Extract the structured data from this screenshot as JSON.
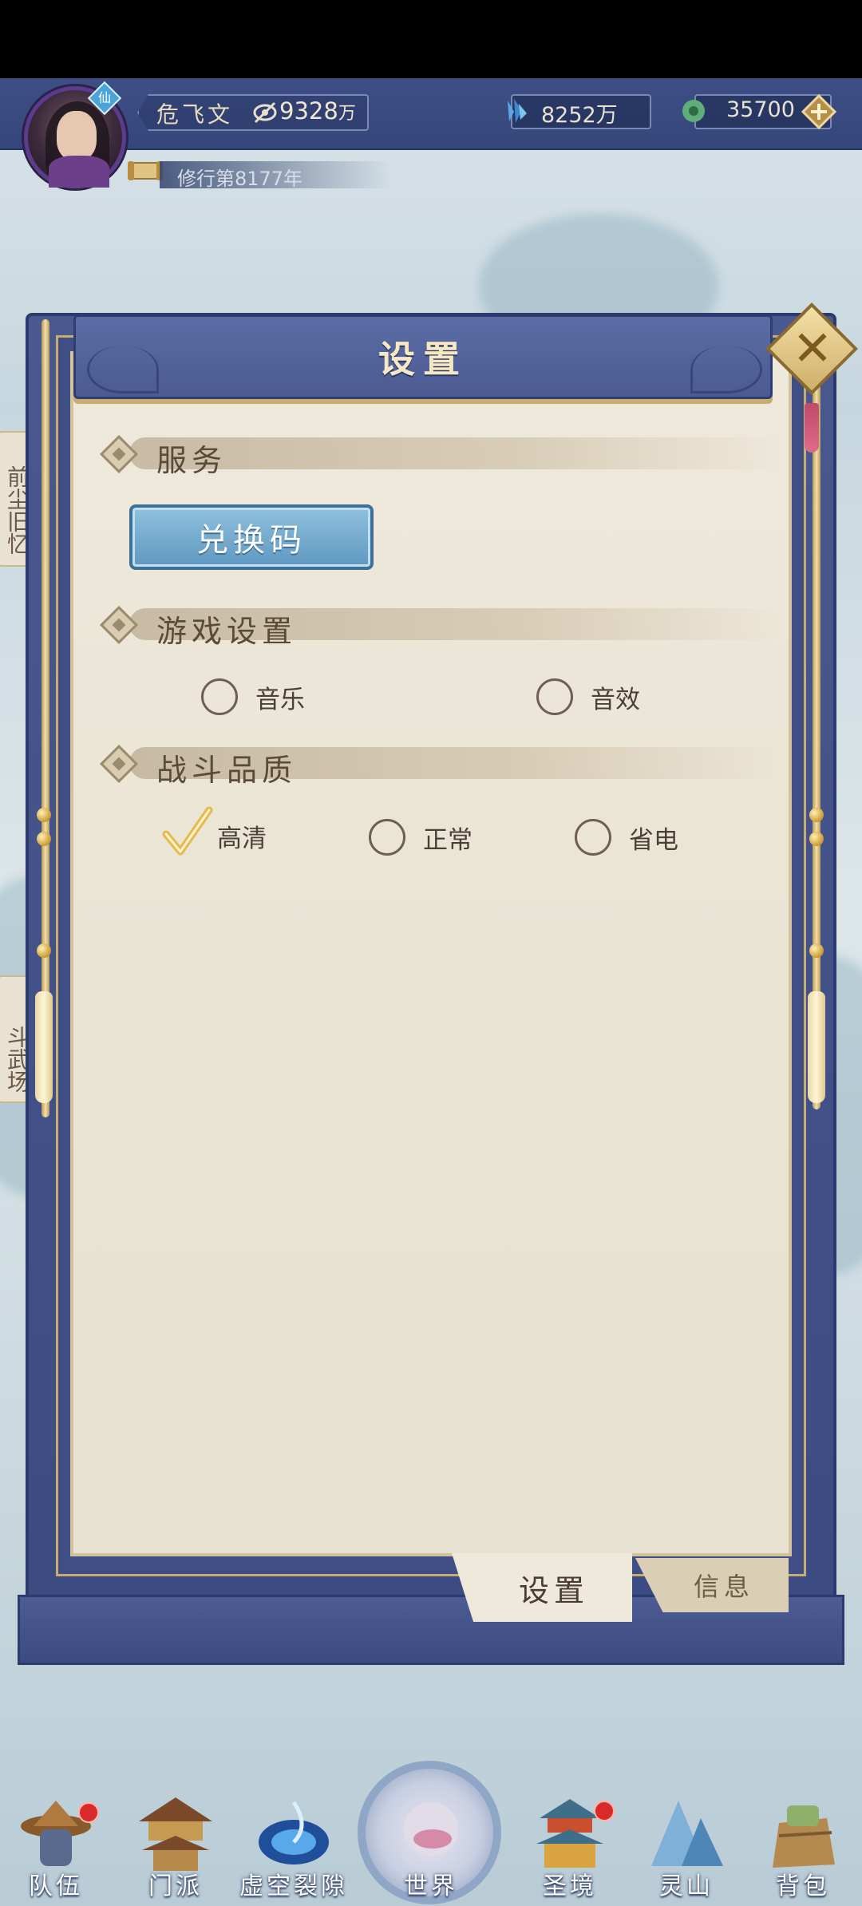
{
  "player": {
    "name": "危飞文",
    "power_value": "9328",
    "power_unit": "万",
    "cultivation": "修行第8177年",
    "badge_icon": "immortal-badge-icon"
  },
  "currencies": [
    {
      "icon": "spirit-crystal-icon",
      "value": "8252万"
    },
    {
      "icon": "jade-coin-icon",
      "value": "35700"
    }
  ],
  "side_tabs": [
    {
      "label": "前尘旧忆"
    },
    {
      "label": "斗武场"
    }
  ],
  "dialog": {
    "title": "设置",
    "close_icon": "close-icon",
    "sections": {
      "service": {
        "label": "服务",
        "redeem_button": "兑换码"
      },
      "game_settings": {
        "label": "游戏设置",
        "options": [
          {
            "label": "音乐",
            "checked": false
          },
          {
            "label": "音效",
            "checked": false
          }
        ]
      },
      "battle_quality": {
        "label": "战斗品质",
        "options": [
          {
            "label": "高清",
            "checked": true
          },
          {
            "label": "正常",
            "checked": false
          },
          {
            "label": "省电",
            "checked": false
          }
        ]
      }
    },
    "tabs": [
      {
        "label": "设置",
        "active": true
      },
      {
        "label": "信息",
        "active": false
      }
    ]
  },
  "bottom_nav": [
    {
      "label": "队伍",
      "icon": "team-icon",
      "badge": true
    },
    {
      "label": "门派",
      "icon": "sect-icon",
      "badge": false
    },
    {
      "label": "虚空裂隙",
      "icon": "void-rift-icon",
      "badge": false
    },
    {
      "label": "世界",
      "icon": "world-icon",
      "badge": false
    },
    {
      "label": "圣境",
      "icon": "holy-realm-icon",
      "badge": true
    },
    {
      "label": "灵山",
      "icon": "spirit-mountain-icon",
      "badge": false
    },
    {
      "label": "背包",
      "icon": "bag-icon",
      "badge": false
    }
  ],
  "colors": {
    "panel_blue": "#4b5b92",
    "paper": "#efe9dc",
    "gold": "#c7ad70",
    "redeem_blue": "#6fa6cc",
    "badge_red": "#d82a2a"
  }
}
